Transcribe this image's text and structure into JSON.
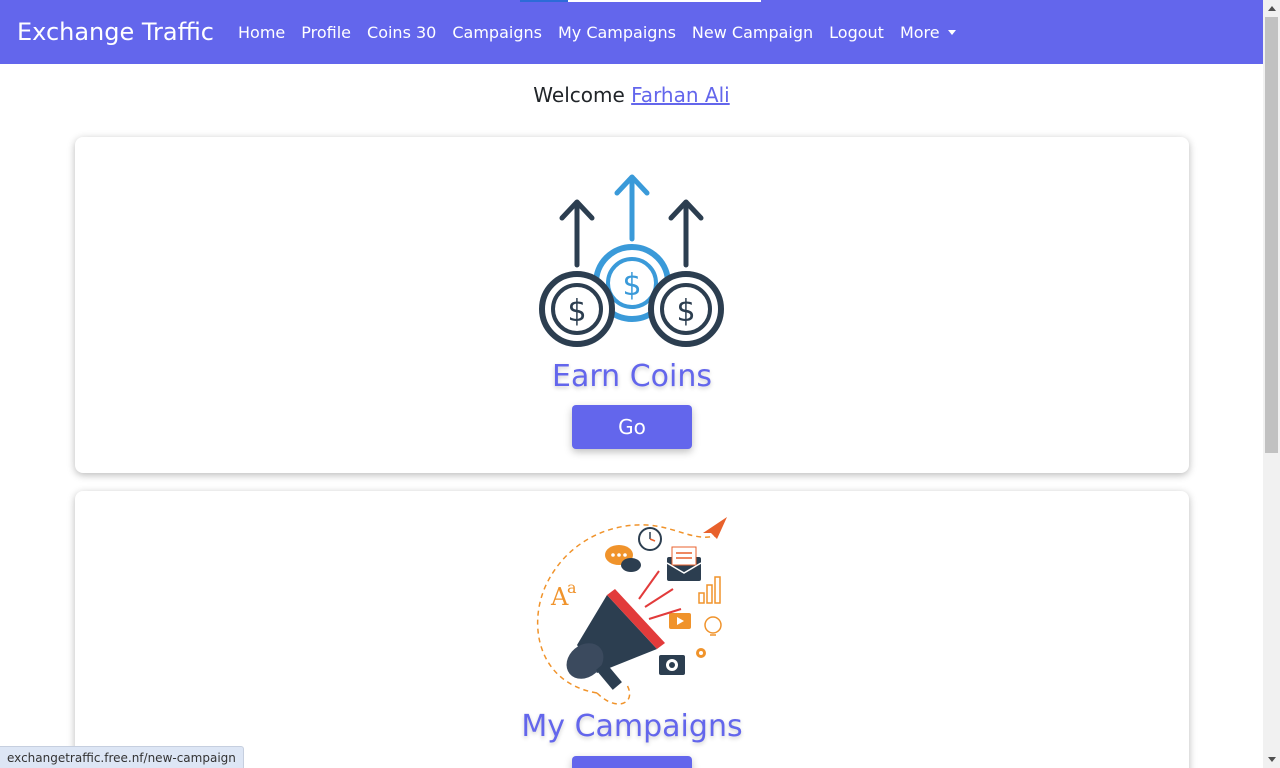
{
  "navbar": {
    "brand": "Exchange Traffic",
    "links": [
      "Home",
      "Profile",
      "Coins 30",
      "Campaigns",
      "My Campaigns",
      "New Campaign",
      "Logout"
    ],
    "more_label": "More"
  },
  "welcome": {
    "prefix": "Welcome",
    "user_name": "Farhan Ali"
  },
  "cards": [
    {
      "title": "Earn Coins",
      "button": "Go",
      "icon": "coins-up-arrows-icon"
    },
    {
      "title": "My Campaigns",
      "button": "",
      "icon": "megaphone-marketing-icon"
    }
  ],
  "status_url": "exchangetraffic.free.nf/new-campaign",
  "colors": {
    "primary": "#6366ec",
    "icon_dark": "#2c3e50",
    "icon_blue": "#3a9ad9",
    "orange": "#f0932b"
  }
}
